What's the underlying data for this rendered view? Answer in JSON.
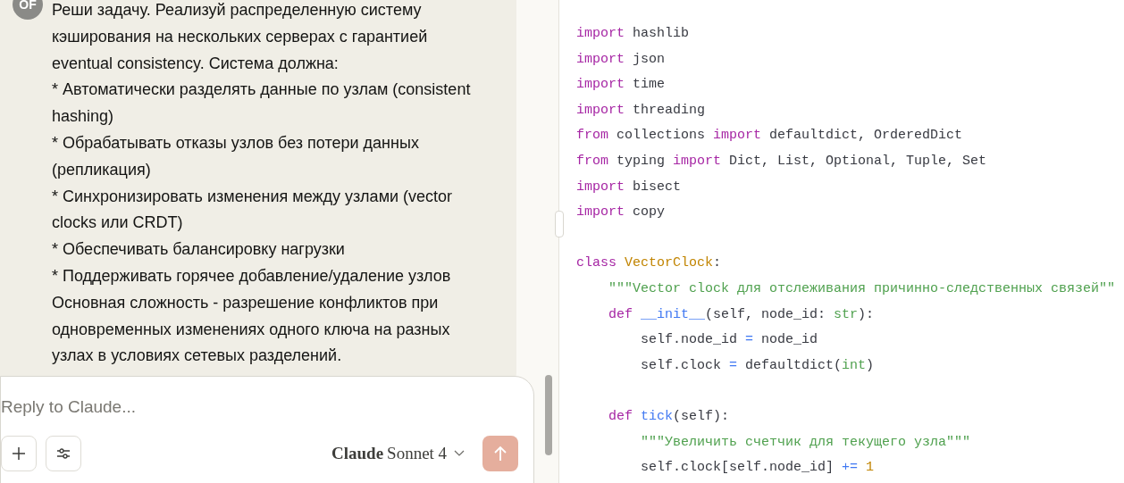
{
  "message": {
    "avatar": "OF",
    "text": "Реши задачу. Реализуй распределенную систему кэширования на нескольких серверах с гарантией eventual consistency. Система должна:\n* Автоматически разделять данные по узлам (consistent hashing)\n* Обрабатывать отказы узлов без потери данных (репликация)\n* Синхронизировать изменения между узлами (vector clocks или CRDT)\n* Обеспечивать балансировку нагрузки\n* Поддерживать горячее добавление/удаление узлов\nОсновная сложность - разрешение конфликтов при одновременных изменениях одного ключа на разных узлах в условиях сетевых разделений."
  },
  "composer": {
    "placeholder": "Reply to Claude...",
    "model_brand": "Claude",
    "model_name": "Sonnet 4"
  },
  "code_lines": [
    {
      "tokens": [
        {
          "kind": "keyword",
          "text": "import"
        },
        {
          "kind": "plain",
          "text": " hashlib"
        }
      ]
    },
    {
      "tokens": [
        {
          "kind": "keyword",
          "text": "import"
        },
        {
          "kind": "plain",
          "text": " json"
        }
      ]
    },
    {
      "tokens": [
        {
          "kind": "keyword",
          "text": "import"
        },
        {
          "kind": "plain",
          "text": " time"
        }
      ]
    },
    {
      "tokens": [
        {
          "kind": "keyword",
          "text": "import"
        },
        {
          "kind": "plain",
          "text": " threading"
        }
      ]
    },
    {
      "tokens": [
        {
          "kind": "keyword",
          "text": "from"
        },
        {
          "kind": "plain",
          "text": " collections "
        },
        {
          "kind": "keyword",
          "text": "import"
        },
        {
          "kind": "plain",
          "text": " defaultdict, OrderedDict"
        }
      ]
    },
    {
      "tokens": [
        {
          "kind": "keyword",
          "text": "from"
        },
        {
          "kind": "plain",
          "text": " typing "
        },
        {
          "kind": "keyword",
          "text": "import"
        },
        {
          "kind": "plain",
          "text": " Dict, List, Optional, Tuple, Set"
        }
      ]
    },
    {
      "tokens": [
        {
          "kind": "keyword",
          "text": "import"
        },
        {
          "kind": "plain",
          "text": " bisect"
        }
      ]
    },
    {
      "tokens": [
        {
          "kind": "keyword",
          "text": "import"
        },
        {
          "kind": "plain",
          "text": " copy"
        }
      ]
    },
    {
      "blank_before": true,
      "tokens": [
        {
          "kind": "keyword",
          "text": "class"
        },
        {
          "kind": "classname",
          "text": " VectorClock"
        },
        {
          "kind": "plain",
          "text": ":"
        }
      ]
    },
    {
      "tokens": [
        {
          "kind": "string",
          "text": "    \"\"\"Vector clock для отслеживания причинно-следственных связей\"\""
        }
      ]
    },
    {
      "tokens": [
        {
          "kind": "keyword",
          "text": "    def"
        },
        {
          "kind": "function",
          "text": " __init__"
        },
        {
          "kind": "plain",
          "text": "(self, node_id: "
        },
        {
          "kind": "builtin",
          "text": "str"
        },
        {
          "kind": "plain",
          "text": "):"
        }
      ]
    },
    {
      "tokens": [
        {
          "kind": "plain",
          "text": "        self.node_id "
        },
        {
          "kind": "operator",
          "text": "="
        },
        {
          "kind": "plain",
          "text": " node_id"
        }
      ]
    },
    {
      "tokens": [
        {
          "kind": "plain",
          "text": "        self.clock "
        },
        {
          "kind": "operator",
          "text": "="
        },
        {
          "kind": "plain",
          "text": " defaultdict("
        },
        {
          "kind": "builtin",
          "text": "int"
        },
        {
          "kind": "plain",
          "text": ")"
        }
      ]
    },
    {
      "blank_before": true,
      "tokens": [
        {
          "kind": "keyword",
          "text": "    def"
        },
        {
          "kind": "function",
          "text": " tick"
        },
        {
          "kind": "plain",
          "text": "(self):"
        }
      ]
    },
    {
      "tokens": [
        {
          "kind": "string",
          "text": "        \"\"\"Увеличить счетчик для текущего узла\"\"\""
        }
      ]
    },
    {
      "tokens": [
        {
          "kind": "plain",
          "text": "        self.clock[self.node_id] "
        },
        {
          "kind": "operator",
          "text": "+="
        },
        {
          "kind": "number",
          "text": " 1"
        }
      ]
    }
  ]
}
